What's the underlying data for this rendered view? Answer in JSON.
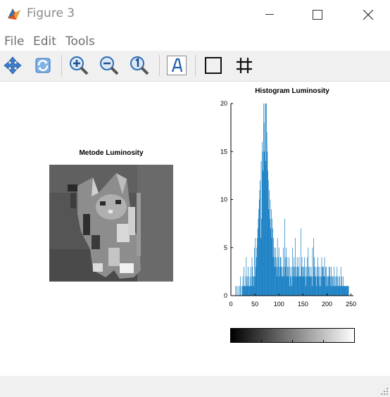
{
  "window": {
    "title": "Figure 3",
    "controls": [
      "minimize",
      "maximize",
      "close"
    ]
  },
  "menu": {
    "items": [
      {
        "label": "File"
      },
      {
        "label": "Edit"
      },
      {
        "label": "Tools"
      }
    ]
  },
  "toolbar": {
    "tools": [
      {
        "icon": "pan-icon"
      },
      {
        "icon": "rotate-icon"
      },
      {
        "icon": "zoom-in-icon"
      },
      {
        "icon": "zoom-out-icon"
      },
      {
        "icon": "zoom-reset-icon"
      },
      {
        "icon": "insert-text-icon"
      },
      {
        "icon": "toggle-box-icon"
      },
      {
        "icon": "toggle-grid-icon"
      }
    ]
  },
  "figure": {
    "image_title": "Metode Luminosity",
    "hist_title": "Histogram Luminosity"
  },
  "chart_data": {
    "type": "bar",
    "title": "Histogram Luminosity",
    "xlabel": "",
    "ylabel": "",
    "xlim": [
      0,
      255
    ],
    "ylim": [
      0,
      20
    ],
    "x_ticks": [
      0,
      50,
      100,
      150,
      200,
      250
    ],
    "y_ticks": [
      0,
      5,
      10,
      15,
      20
    ],
    "bar_color": "#0072BD",
    "x": [
      10,
      12,
      15,
      18,
      20,
      22,
      24,
      25,
      26,
      27,
      28,
      29,
      30,
      31,
      32,
      33,
      34,
      35,
      36,
      37,
      38,
      39,
      40,
      41,
      42,
      43,
      44,
      45,
      46,
      47,
      48,
      49,
      50,
      51,
      52,
      53,
      54,
      55,
      56,
      57,
      58,
      59,
      60,
      61,
      62,
      63,
      64,
      65,
      66,
      67,
      68,
      69,
      70,
      71,
      72,
      73,
      74,
      75,
      76,
      77,
      78,
      79,
      80,
      81,
      82,
      83,
      84,
      85,
      86,
      87,
      88,
      89,
      90,
      91,
      92,
      93,
      94,
      95,
      96,
      97,
      98,
      99,
      100,
      101,
      102,
      103,
      104,
      105,
      106,
      107,
      108,
      109,
      110,
      111,
      112,
      113,
      114,
      115,
      116,
      117,
      118,
      119,
      120,
      121,
      122,
      123,
      124,
      125,
      126,
      127,
      128,
      129,
      130,
      131,
      132,
      133,
      134,
      135,
      136,
      137,
      138,
      139,
      140,
      141,
      142,
      143,
      144,
      145,
      146,
      147,
      148,
      149,
      150,
      151,
      152,
      153,
      154,
      155,
      156,
      157,
      158,
      159,
      160,
      161,
      162,
      163,
      164,
      165,
      166,
      167,
      168,
      169,
      170,
      171,
      172,
      173,
      174,
      175,
      176,
      177,
      178,
      179,
      180,
      181,
      182,
      183,
      184,
      185,
      186,
      187,
      188,
      189,
      190,
      191,
      192,
      193,
      194,
      195,
      196,
      197,
      198,
      199,
      200,
      201,
      202,
      203,
      204,
      205,
      206,
      207,
      208,
      209,
      210,
      211,
      212,
      213,
      214,
      215,
      216,
      217,
      218,
      219,
      220,
      221,
      222,
      223,
      224,
      225,
      226,
      227,
      228,
      229,
      230,
      231,
      232,
      233,
      234,
      235,
      236,
      237,
      238,
      239,
      240,
      241,
      242,
      243,
      244,
      245,
      246,
      247,
      248,
      249,
      250
    ],
    "values": [
      1,
      1,
      1,
      1,
      2,
      1,
      1,
      2,
      1,
      3,
      1,
      1,
      1,
      2,
      4,
      1,
      2,
      1,
      3,
      1,
      2,
      1,
      1,
      3,
      2,
      1,
      4,
      3,
      2,
      1,
      2,
      5,
      2,
      6,
      3,
      4,
      5,
      6,
      7,
      8,
      9,
      10,
      11,
      12,
      6,
      14,
      8,
      16,
      15,
      13,
      20,
      18,
      15,
      20,
      14,
      20,
      20,
      17,
      15,
      13,
      12,
      9,
      11,
      8,
      10,
      7,
      9,
      6,
      8,
      7,
      4,
      6,
      5,
      3,
      4,
      5,
      3,
      4,
      2,
      6,
      3,
      4,
      5,
      2,
      3,
      4,
      4,
      3,
      2,
      3,
      2,
      5,
      3,
      2,
      8,
      4,
      3,
      5,
      2,
      4,
      3,
      2,
      3,
      4,
      1,
      3,
      2,
      2,
      3,
      1,
      5,
      2,
      3,
      4,
      2,
      3,
      6,
      2,
      3,
      2,
      4,
      3,
      2,
      3,
      4,
      2,
      2,
      2,
      7,
      3,
      4,
      2,
      3,
      3,
      2,
      4,
      2,
      3,
      1,
      2,
      3,
      4,
      2,
      5,
      3,
      2,
      3,
      2,
      2,
      3,
      2,
      1,
      5,
      2,
      6,
      3,
      4,
      2,
      3,
      2,
      1,
      3,
      2,
      4,
      3,
      2,
      1,
      3,
      2,
      1,
      2,
      4,
      3,
      3,
      2,
      3,
      2,
      4,
      2,
      3,
      1,
      3,
      2,
      2,
      1,
      2,
      3,
      2,
      3,
      2,
      1,
      3,
      2,
      1,
      2,
      1,
      2,
      3,
      1,
      2,
      1,
      2,
      1,
      3,
      2,
      1,
      1,
      2,
      2,
      1,
      1,
      3,
      1,
      2,
      1,
      1,
      2,
      1,
      1,
      1,
      1,
      1,
      1,
      1,
      1,
      1,
      1,
      1
    ]
  },
  "colorbar": {
    "range": [
      0,
      255
    ],
    "colormap": "gray"
  }
}
